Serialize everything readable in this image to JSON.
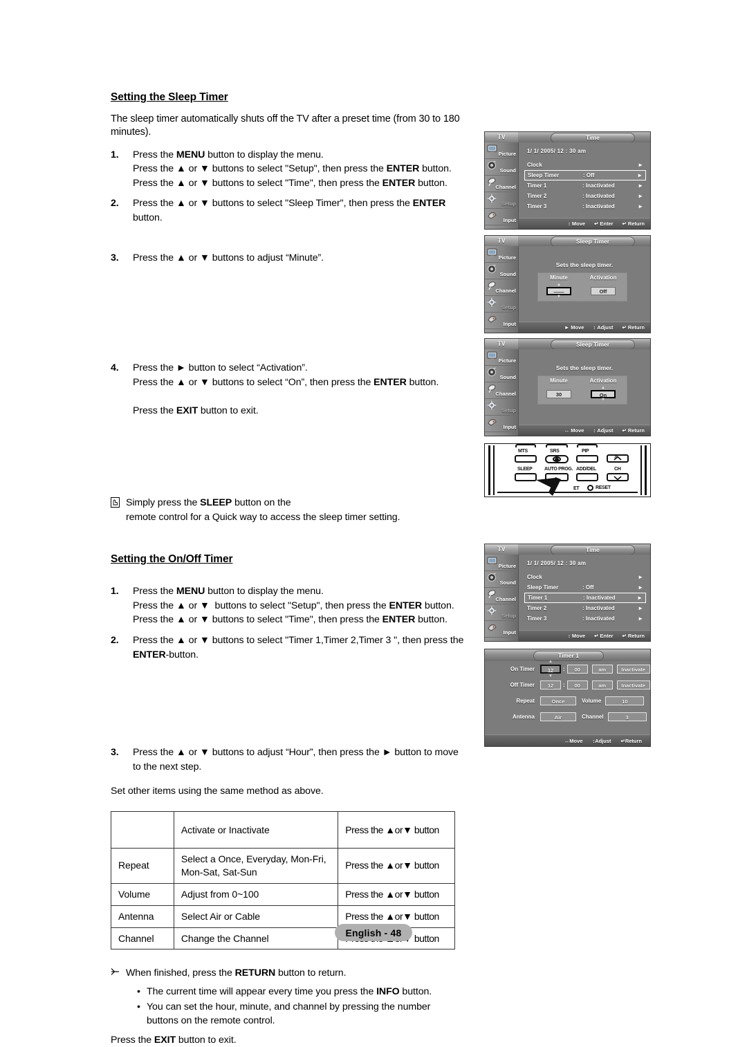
{
  "doc": {
    "footer_label": "English - 48"
  },
  "section1": {
    "title": "Setting the Sleep Timer",
    "intro": "The sleep timer automatically shuts off the TV after a preset time (from 30 to 180 minutes).",
    "steps": [
      {
        "num": "1.",
        "lines": [
          "Press the MENU button to display the menu.",
          "Press the ▲ or ▼ buttons to select \"Setup\", then press the ENTER button.",
          "Press the ▲ or ▼ buttons to select \"Time\", then press the ENTER button."
        ]
      },
      {
        "num": "2.",
        "lines": [
          "Press the ▲ or ▼ buttons to select \"Sleep Timer\", then press the ENTER button."
        ]
      },
      {
        "num": "3.",
        "lines": [
          "Press the ▲ or ▼ buttons to adjust “Minute”."
        ]
      },
      {
        "num": "4.",
        "lines": [
          "Press the ► button to select “Activation”.",
          "Press the ▲ or ▼ buttons to select “On”, then press the ENTER button."
        ]
      }
    ],
    "exit_line": "Press the EXIT button to exit.",
    "note": {
      "line1": "Simply press the SLEEP button on the",
      "line2": "remote control for a Quick way to access the sleep timer setting."
    }
  },
  "section2": {
    "title": "Setting the On/Off Timer",
    "steps": [
      {
        "num": "1.",
        "lines": [
          "Press the MENU button to display the menu.",
          "Press the ▲ or ▼  buttons to select \"Setup\", then press the ENTER button.",
          "Press the ▲ or ▼ buttons to select \"Time\", then press the ENTER button."
        ]
      },
      {
        "num": "2.",
        "lines": [
          "Press the ▲ or ▼ buttons to select \"Timer 1,Timer 2,Timer 3 \", then press the",
          "ENTER-button."
        ]
      },
      {
        "num": "3.",
        "lines": [
          "Press the ▲ or ▼ buttons to adjust “Hour”, then press the ► button to move",
          "to the next step."
        ]
      }
    ],
    "after_steps": "Set other items using the same method as above.",
    "table": {
      "rows": [
        {
          "c1": "",
          "c2": "Activate or Inactivate",
          "c3": "Press the ▲or▼ button"
        },
        {
          "c1": "Repeat",
          "c2": "Select a Once, Everyday, Mon-Fri,\nMon-Sat, Sat-Sun",
          "c3": "Press the ▲or▼ button"
        },
        {
          "c1": "Volume",
          "c2": "Adjust from 0~100",
          "c3": "Press the ▲or▼ button"
        },
        {
          "c1": "Antenna",
          "c2": "Select Air or Cable",
          "c3": "Press the ▲or▼ button"
        },
        {
          "c1": "Channel",
          "c2": "Change the Channel",
          "c3": "Press the ▲or▼ button"
        }
      ]
    },
    "note_return": "When finished, press the RETURN button to return.",
    "bullets": [
      "The current time will appear every time you press the INFO button.",
      "You can set the hour, minute, and channel by pressing the number\nbuttons on the remote control."
    ],
    "exit_line": "Press the EXIT button to exit."
  },
  "osd": {
    "tv_label": "TV",
    "sidebar": [
      {
        "label": "Picture",
        "icon": "tv-screen-icon",
        "dim": false
      },
      {
        "label": "Sound",
        "icon": "speaker-icon",
        "dim": false
      },
      {
        "label": "Channel",
        "icon": "satellite-dish-icon",
        "dim": false
      },
      {
        "label": "Setup",
        "icon": "gear-icon",
        "dim": true
      },
      {
        "label": "Input",
        "icon": "plug-icon",
        "dim": false
      }
    ],
    "footer_move": "Move",
    "footer_enter": "Enter",
    "footer_return": "Return",
    "footer_adjust": "Adjust",
    "time_menu_1": {
      "title": "Time",
      "clock": "1/ 1/ 2005/ 12 : 30 am",
      "rows": [
        {
          "label": "Clock",
          "value": "",
          "selected": false
        },
        {
          "label": "Sleep Timer",
          "value": ": Off",
          "selected": true
        },
        {
          "label": "Timer 1",
          "value": ": Inactivated",
          "selected": false
        },
        {
          "label": "Timer 2",
          "value": ": Inactivated",
          "selected": false
        },
        {
          "label": "Timer 3",
          "value": ": Inactivated",
          "selected": false
        }
      ]
    },
    "time_menu_2": {
      "title": "Time",
      "clock": "1/ 1/ 2005/ 12 : 30 am",
      "rows": [
        {
          "label": "Clock",
          "value": "",
          "selected": false
        },
        {
          "label": "Sleep Timer",
          "value": ": Off",
          "selected": false
        },
        {
          "label": "Timer 1",
          "value": ": Inactivated",
          "selected": true
        },
        {
          "label": "Timer 2",
          "value": ": Inactivated",
          "selected": false
        },
        {
          "label": "Timer 3",
          "value": ": Inactivated",
          "selected": false
        }
      ]
    },
    "sleep_a": {
      "title": "Sleep Timer",
      "caption": "Sets the sleep timer.",
      "head_minute": "Minute",
      "head_activation": "Activation",
      "minute_value": "——",
      "activation_value": "Off",
      "focus": "minute",
      "footer_move": "Move",
      "footer_adjust": "Adjust",
      "footer_return": "Return"
    },
    "sleep_b": {
      "title": "Sleep Timer",
      "caption": "Sets the sleep timer.",
      "head_minute": "Minute",
      "head_activation": "Activation",
      "minute_value": "30",
      "activation_value": "On",
      "focus": "activation",
      "footer_move": "Move",
      "footer_adjust": "Adjust",
      "footer_return": "Return"
    },
    "timer1": {
      "title": "Timer 1",
      "rows": {
        "on_timer_label": "On Timer",
        "on_hour": "12",
        "on_min": "00",
        "on_ampm": "am",
        "on_state": "Inactivate",
        "off_timer_label": "Off Timer",
        "off_hour": "12",
        "off_min": "00",
        "off_ampm": "am",
        "off_state": "Inactivate",
        "repeat_label": "Repeat",
        "repeat_value": "Once",
        "volume_label": "Volume",
        "volume_value": "10",
        "antenna_label": "Antenna",
        "antenna_value": "Air",
        "channel_label": "Channel",
        "channel_value": "3"
      },
      "footer_move": "Move",
      "footer_adjust": "Adjust",
      "footer_return": "Return"
    }
  },
  "remote": {
    "buttons": [
      {
        "name": "mts",
        "label": "MTS"
      },
      {
        "name": "srs",
        "label": "SRS"
      },
      {
        "name": "pip",
        "label": "PIP"
      },
      {
        "name": "sleep",
        "label": "SLEEP"
      },
      {
        "name": "auto-prog",
        "label": "AUTO PROG."
      },
      {
        "name": "add-del",
        "label": "ADD/DEL"
      },
      {
        "name": "ch",
        "label": "CH"
      },
      {
        "name": "reset",
        "label": "RESET"
      },
      {
        "name": "set-partial",
        "label": "ET"
      }
    ]
  },
  "colors": {
    "osd_bg": "#7c7c7c",
    "osd_bar": "#4f4f4f",
    "footer_pill": "#b0b0b0"
  }
}
